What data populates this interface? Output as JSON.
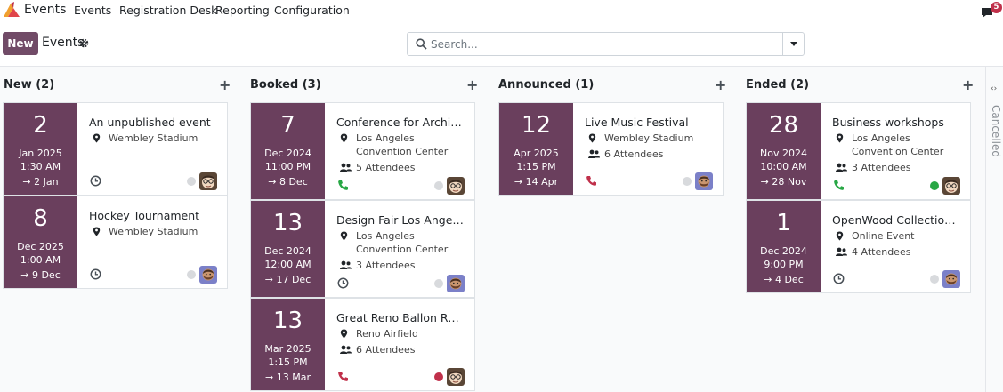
{
  "app": {
    "title": "Events"
  },
  "menu": [
    "Events",
    "Registration Desk",
    "Reporting",
    "Configuration"
  ],
  "notifications": {
    "count": "5"
  },
  "control": {
    "new_label": "New",
    "breadcrumb": "Events",
    "search_placeholder": "Search..."
  },
  "columns": [
    {
      "title": "New (2)",
      "cards": [
        {
          "day": "2",
          "month": "Jan 2025",
          "time": "1:30 AM",
          "end": "→ 2 Jan",
          "title": "An unpublished event",
          "location": [
            "Wembley Stadium"
          ],
          "attendees": "",
          "status_icon": "clock-icon",
          "dot": "",
          "avatar": "glasses"
        },
        {
          "day": "8",
          "month": "Dec 2025",
          "time": "1:00 AM",
          "end": "→ 9 Dec",
          "title": "Hockey Tournament",
          "location": [
            "Wembley Stadium"
          ],
          "attendees": "",
          "status_icon": "clock-icon",
          "dot": "",
          "avatar": "beard"
        }
      ]
    },
    {
      "title": "Booked (3)",
      "cards": [
        {
          "day": "7",
          "month": "Dec 2024",
          "time": "11:00 PM",
          "end": "→ 8 Dec",
          "title": "Conference for Archite...",
          "location": [
            "Los Angeles",
            "Convention Center"
          ],
          "attendees": "5 Attendees",
          "status_icon": "phone-icon",
          "dot": "",
          "avatar": "glasses"
        },
        {
          "day": "13",
          "month": "Dec 2024",
          "time": "12:00 AM",
          "end": "→ 17 Dec",
          "title": "Design Fair Los Angeles",
          "location": [
            "Los Angeles",
            "Convention Center"
          ],
          "attendees": "3 Attendees",
          "status_icon": "clock-icon",
          "dot": "",
          "avatar": "beard"
        },
        {
          "day": "13",
          "month": "Mar 2025",
          "time": "1:15 PM",
          "end": "→ 13 Mar",
          "title": "Great Reno Ballon Race",
          "location": [
            "Reno Airfield"
          ],
          "attendees": "6 Attendees",
          "status_icon": "phone-icon",
          "dot": "red",
          "avatar": "glasses"
        }
      ]
    },
    {
      "title": "Announced (1)",
      "cards": [
        {
          "day": "12",
          "month": "Apr 2025",
          "time": "1:15 PM",
          "end": "→ 14 Apr",
          "title": "Live Music Festival",
          "location": [
            "Wembley Stadium"
          ],
          "attendees": "6 Attendees",
          "status_icon": "phone-icon",
          "dot": "",
          "avatar": "beard"
        }
      ]
    },
    {
      "title": "Ended (2)",
      "cards": [
        {
          "day": "28",
          "month": "Nov 2024",
          "time": "10:00 AM",
          "end": "→ 28 Nov",
          "title": "Business workshops",
          "location": [
            "Los Angeles",
            "Convention Center"
          ],
          "attendees": "3 Attendees",
          "status_icon": "phone-icon",
          "dot": "green",
          "avatar": "glasses"
        },
        {
          "day": "1",
          "month": "Dec 2024",
          "time": "9:00 PM",
          "end": "→ 4 Dec",
          "title": "OpenWood Collection ...",
          "location": [
            "Online Event"
          ],
          "attendees": "4 Attendees",
          "status_icon": "clock-icon",
          "dot": "",
          "avatar": "beard"
        }
      ]
    }
  ],
  "folded": {
    "label": "Cancelled"
  },
  "colors": {
    "brand": "#714b67",
    "date_block": "#6a3f5d",
    "dot_red": "#c0304a",
    "dot_green": "#28a745",
    "dot_grey": "#d8dadd",
    "phone_green": "#28a745",
    "phone_red": "#c0304a"
  }
}
